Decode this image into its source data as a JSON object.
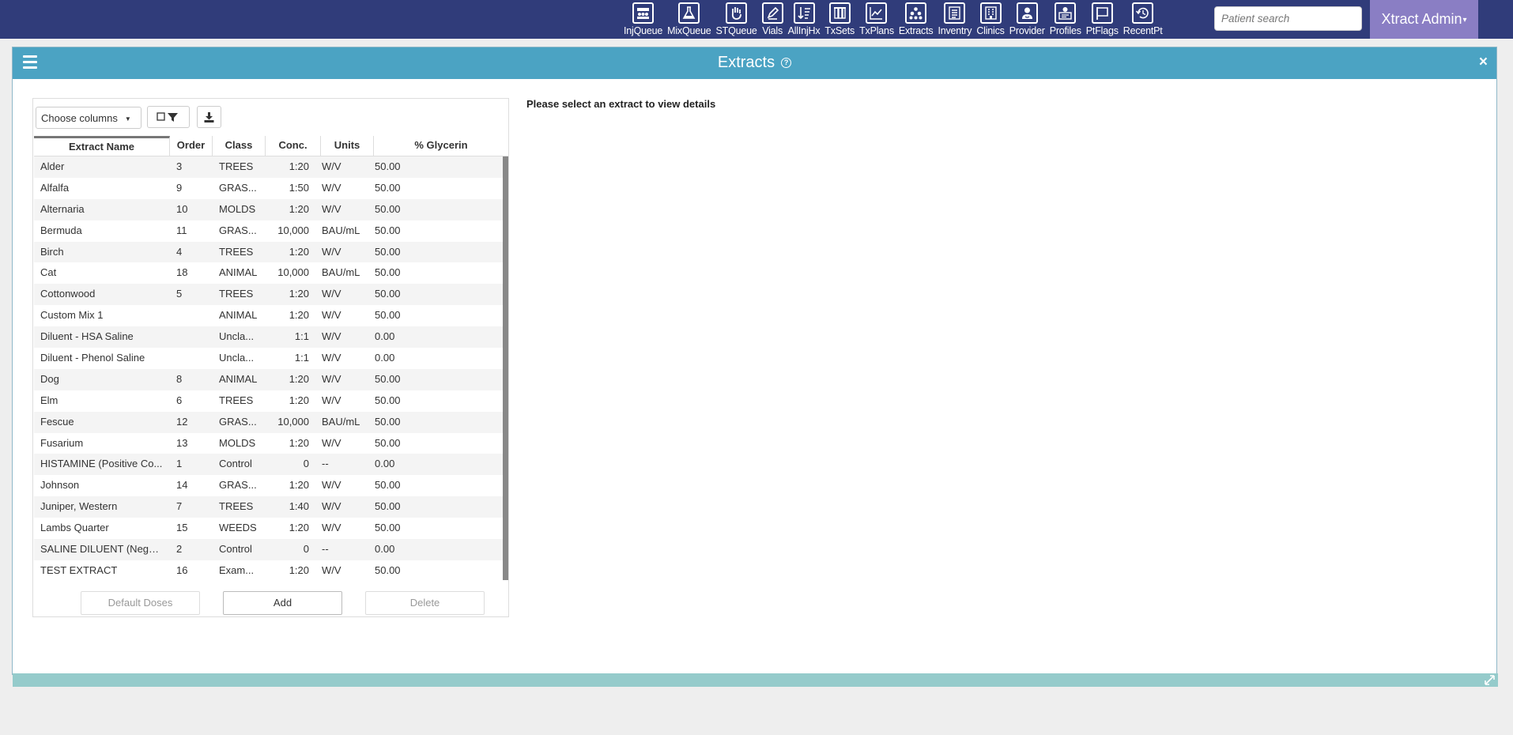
{
  "nav": {
    "items": [
      {
        "label": "InjQueue",
        "icon": "people-group-icon"
      },
      {
        "label": "MixQueue",
        "icon": "flask-icon"
      },
      {
        "label": "STQueue",
        "icon": "hand-icon"
      },
      {
        "label": "Vials",
        "icon": "pencil-vial-icon"
      },
      {
        "label": "AllInjHx",
        "icon": "sort-list-icon"
      },
      {
        "label": "TxSets",
        "icon": "vials-set-icon"
      },
      {
        "label": "TxPlans",
        "icon": "line-chart-icon"
      },
      {
        "label": "Extracts",
        "icon": "dots-cluster-icon"
      },
      {
        "label": "Inventry",
        "icon": "list-document-icon"
      },
      {
        "label": "Clinics",
        "icon": "building-icon"
      },
      {
        "label": "Provider",
        "icon": "doctor-icon"
      },
      {
        "label": "Profiles",
        "icon": "person-card-icon"
      },
      {
        "label": "PtFlags",
        "icon": "flag-icon"
      },
      {
        "label": "RecentPt",
        "icon": "history-icon"
      }
    ],
    "search_placeholder": "Patient search",
    "admin_label": "Xtract Admin"
  },
  "panel": {
    "title": "Extracts",
    "details_message": "Please select an extract to view details"
  },
  "grid": {
    "choose_columns_label": "Choose columns",
    "columns": [
      "Extract Name",
      "Order",
      "Class",
      "Conc.",
      "Units",
      "% Glycerin"
    ],
    "rows": [
      [
        "Alder",
        "3",
        "TREES",
        "1:20",
        "W/V",
        "50.00"
      ],
      [
        "Alfalfa",
        "9",
        "GRAS...",
        "1:50",
        "W/V",
        "50.00"
      ],
      [
        "Alternaria",
        "10",
        "MOLDS",
        "1:20",
        "W/V",
        "50.00"
      ],
      [
        "Bermuda",
        "11",
        "GRAS...",
        "10,000",
        "BAU/mL",
        "50.00"
      ],
      [
        "Birch",
        "4",
        "TREES",
        "1:20",
        "W/V",
        "50.00"
      ],
      [
        "Cat",
        "18",
        "ANIMAL",
        "10,000",
        "BAU/mL",
        "50.00"
      ],
      [
        "Cottonwood",
        "5",
        "TREES",
        "1:20",
        "W/V",
        "50.00"
      ],
      [
        "Custom Mix 1",
        "",
        "ANIMAL",
        "1:20",
        "W/V",
        "50.00"
      ],
      [
        "Diluent - HSA Saline",
        "",
        "Uncla...",
        "1:1",
        "W/V",
        "0.00"
      ],
      [
        "Diluent - Phenol Saline",
        "",
        "Uncla...",
        "1:1",
        "W/V",
        "0.00"
      ],
      [
        "Dog",
        "8",
        "ANIMAL",
        "1:20",
        "W/V",
        "50.00"
      ],
      [
        "Elm",
        "6",
        "TREES",
        "1:20",
        "W/V",
        "50.00"
      ],
      [
        "Fescue",
        "12",
        "GRAS...",
        "10,000",
        "BAU/mL",
        "50.00"
      ],
      [
        "Fusarium",
        "13",
        "MOLDS",
        "1:20",
        "W/V",
        "50.00"
      ],
      [
        "HISTAMINE (Positive Co...",
        "1",
        "Control",
        "0",
        "--",
        "0.00"
      ],
      [
        "Johnson",
        "14",
        "GRAS...",
        "1:20",
        "W/V",
        "50.00"
      ],
      [
        "Juniper, Western",
        "7",
        "TREES",
        "1:40",
        "W/V",
        "50.00"
      ],
      [
        "Lambs Quarter",
        "15",
        "WEEDS",
        "1:20",
        "W/V",
        "50.00"
      ],
      [
        "SALINE DILUENT (Negati...",
        "2",
        "Control",
        "0",
        "--",
        "0.00"
      ],
      [
        "TEST EXTRACT",
        "16",
        "Exam...",
        "1:20",
        "W/V",
        "50.00"
      ]
    ],
    "buttons": {
      "default_doses": "Default Doses",
      "add": "Add",
      "delete": "Delete"
    }
  }
}
